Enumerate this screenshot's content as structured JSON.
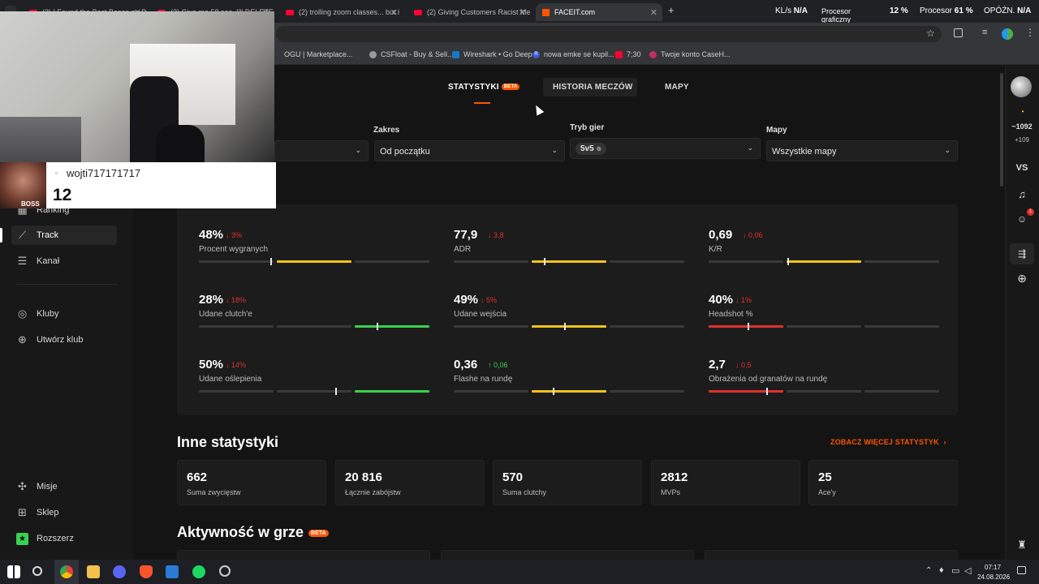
{
  "browser": {
    "tabs": [
      {
        "title": "(2) I Found the Best Bases on D"
      },
      {
        "title": "(2) Give me 58 sec..I'll DELETE y"
      },
      {
        "title": "(2) trolling zoom classes... but i"
      },
      {
        "title": "(2) Giving Customers Racist Me"
      },
      {
        "title": "FACEIT.com"
      }
    ],
    "new_tab": "+",
    "close_glyph": "✕",
    "bookmarks": [
      "OGU | Marketplace...",
      "CSFloat - Buy & Sell...",
      "Wireshark • Go Deep",
      "nowa emke se kupil...",
      "7;30",
      "Twoje konto CaseH..."
    ],
    "bookmark_badge": "R"
  },
  "overlay": {
    "kls_label": "KL/s",
    "kls_value": "N/A",
    "gpu_label": "Procesor graficzny",
    "gpu_value": "12 %",
    "cpu_label": "Procesor",
    "cpu_value": "61 %",
    "lag_label": "OPÓŹN.",
    "lag_value": "N/A"
  },
  "stream": {
    "username": "wojti717171717",
    "count": "12",
    "badge": "BOSS"
  },
  "leftnav": {
    "ranking": "Ranking",
    "track": "Track",
    "kanal": "Kanał",
    "kluby": "Kluby",
    "utworz": "Utwórz klub",
    "misje": "Misje",
    "sklep": "Sklep",
    "rozszerz": "Rozszerz"
  },
  "rightnav": {
    "elo": "~1092",
    "elo_delta": "+109",
    "vs": "VS",
    "notif_count": "1"
  },
  "tabs": {
    "statystyki": "STATYSTYKI",
    "beta": "BETA",
    "historia": "HISTORIA MECZÓW",
    "mapy": "MAPY"
  },
  "filters": {
    "zakres_label": "Zakres",
    "zakres_value": "Od początku",
    "tryb_label": "Tryb gier",
    "tryb_value": "5v5",
    "mapy_label": "Mapy",
    "mapy_value": "Wszystkie mapy"
  },
  "stats": [
    {
      "value": "48%",
      "delta": "↓ 3%",
      "dir": "down",
      "label": "Procent wygranych",
      "level": 0.31,
      "zone": 1,
      "color": "#f0c419"
    },
    {
      "value": "77,9",
      "delta": "↓ 3,8",
      "dir": "down",
      "label": "ADR",
      "level": 0.39,
      "zone": 1,
      "color": "#f0c419"
    },
    {
      "value": "0,69",
      "delta": "↓ 0,06",
      "dir": "down",
      "label": "K/R",
      "level": 0.34,
      "zone": 1,
      "color": "#f0c419"
    },
    {
      "value": "28%",
      "delta": "↓ 18%",
      "dir": "down",
      "label": "Udane clutch'e",
      "level": 0.77,
      "zone": 2,
      "color": "#3ad04f"
    },
    {
      "value": "49%",
      "delta": "↓ 5%",
      "dir": "down",
      "label": "Udane wejścia",
      "level": 0.48,
      "zone": 1,
      "color": "#f0c419"
    },
    {
      "value": "40%",
      "delta": "↓ 1%",
      "dir": "down",
      "label": "Headshot %",
      "level": 0.17,
      "zone": 0,
      "color": "#e0312f"
    },
    {
      "value": "50%",
      "delta": "↓ 14%",
      "dir": "down",
      "label": "Udane oślepienia",
      "level": 0.59,
      "zone": 2,
      "color": "#3ad04f"
    },
    {
      "value": "0,36",
      "delta": "↑ 0,06",
      "dir": "up",
      "label": "Flashe na rundę",
      "level": 0.43,
      "zone": 1,
      "color": "#f0c419"
    },
    {
      "value": "2,7",
      "delta": "↓ 0,5",
      "dir": "down",
      "label": "Obrażenia od granatów na rundę",
      "level": 0.25,
      "zone": 0,
      "color": "#e0312f"
    }
  ],
  "inne": {
    "title": "Inne statystyki",
    "more": "ZOBACZ WIĘCEJ STATYSTYK",
    "cards": [
      {
        "value": "662",
        "label": "Suma zwycięstw"
      },
      {
        "value": "20 816",
        "label": "Łącznie zabójstw"
      },
      {
        "value": "570",
        "label": "Suma clutchy"
      },
      {
        "value": "2812",
        "label": "MVPs"
      },
      {
        "value": "25",
        "label": "Ace'y"
      }
    ]
  },
  "aktywnosc": {
    "title": "Aktywność w grze",
    "beta": "BETA"
  },
  "taskbar": {
    "time": "07:17",
    "date": "24.08.2026"
  },
  "colors": {
    "accent": "#ff5500",
    "good": "#3ad04f",
    "mid": "#f0c419",
    "bad": "#e0312f"
  }
}
